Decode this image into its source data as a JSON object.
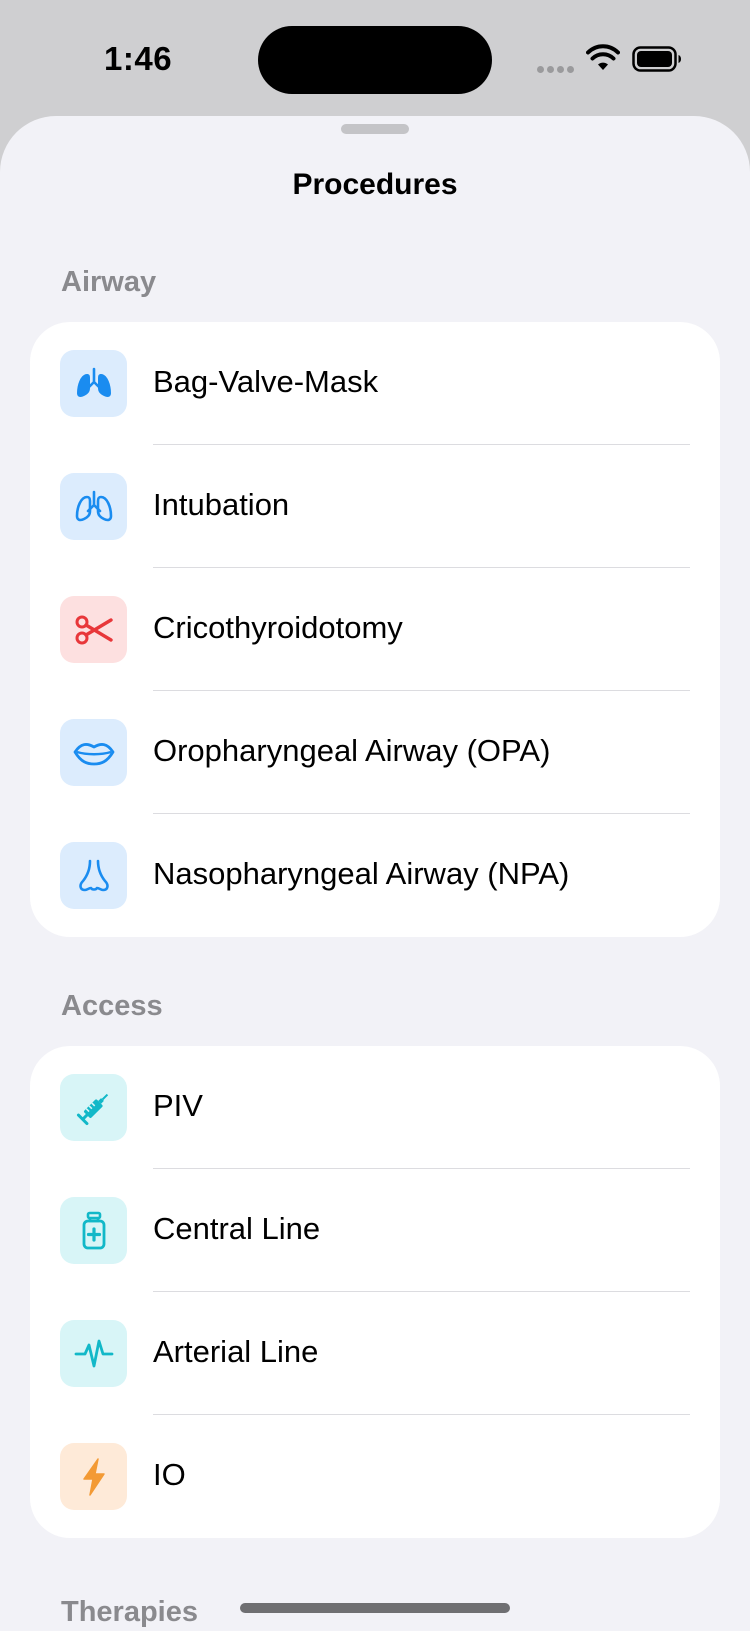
{
  "status_bar": {
    "time": "1:46"
  },
  "sheet": {
    "title": "Procedures"
  },
  "colors": {
    "blue_icon": "#1a8cf0",
    "red_icon": "#e8373a",
    "teal_icon": "#12b8c8",
    "orange_icon": "#f39a34"
  },
  "sections": [
    {
      "header": "Airway",
      "items": [
        {
          "label": "Bag-Valve-Mask",
          "icon": "lungs-filled-icon"
        },
        {
          "label": "Intubation",
          "icon": "lungs-icon"
        },
        {
          "label": "Cricothyroidotomy",
          "icon": "scissors-icon"
        },
        {
          "label": "Oropharyngeal Airway (OPA)",
          "icon": "mouth-icon"
        },
        {
          "label": "Nasopharyngeal Airway (NPA)",
          "icon": "nose-icon"
        }
      ]
    },
    {
      "header": "Access",
      "items": [
        {
          "label": "PIV",
          "icon": "syringe-icon"
        },
        {
          "label": "Central Line",
          "icon": "medication-vial-icon"
        },
        {
          "label": "Arterial Line",
          "icon": "waveform-icon"
        },
        {
          "label": "IO",
          "icon": "bolt-icon"
        }
      ]
    },
    {
      "header": "Therapies",
      "items": []
    }
  ]
}
